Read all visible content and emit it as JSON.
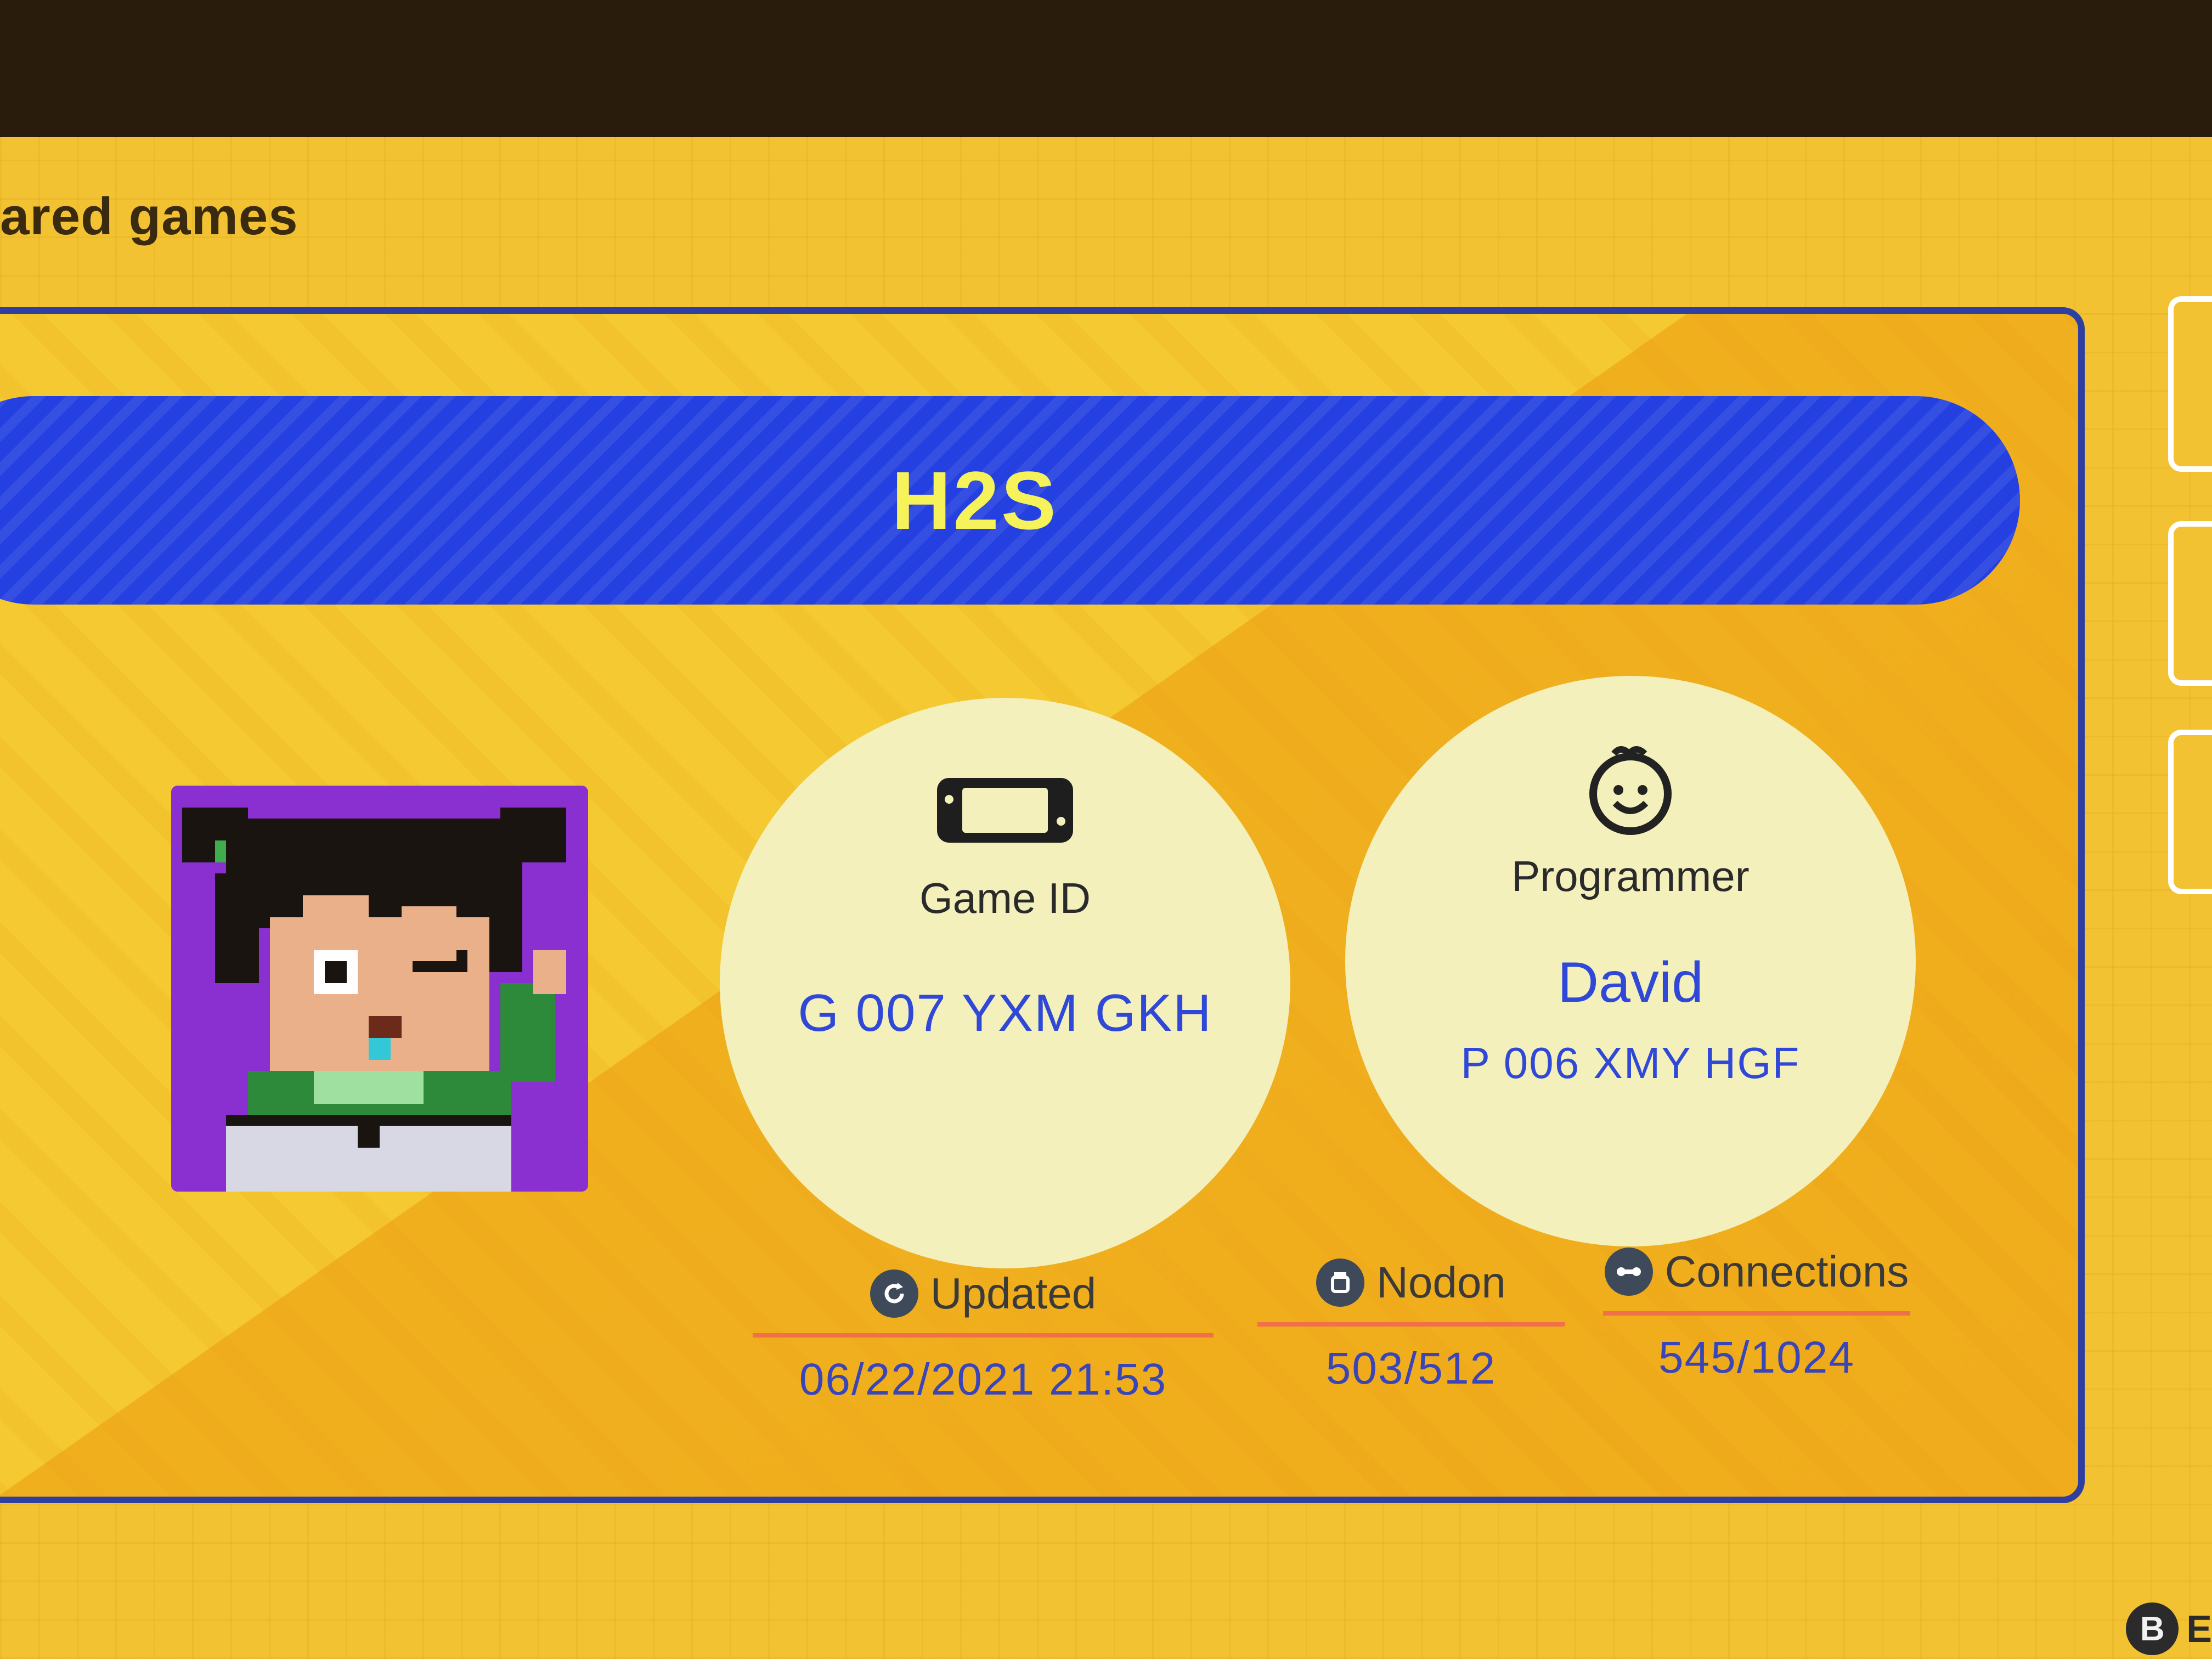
{
  "header": {
    "section_title": "ared games"
  },
  "game": {
    "title": "H2S",
    "thumbnail_icon": "pixel-art-character-thumbnail",
    "game_id": {
      "label": "Game ID",
      "value": "G 007 YXM GKH",
      "icon": "game-console-icon"
    },
    "programmer": {
      "label": "Programmer",
      "name": "David",
      "id": "P 006 XMY HGF",
      "icon": "programmer-face-icon"
    },
    "stats": {
      "updated": {
        "label": "Updated",
        "value": "06/22/2021 21:53",
        "icon": "refresh-icon"
      },
      "nodon": {
        "label": "Nodon",
        "value": "503/512",
        "icon": "nodon-icon"
      },
      "connections": {
        "label": "Connections",
        "value": "545/1024",
        "icon": "connection-icon"
      }
    }
  },
  "footer": {
    "button_glyph": "B",
    "hint_fragment": "E"
  },
  "colors": {
    "background": "#f2c233",
    "banner": "#2440e0",
    "title_text": "#f6f25a",
    "circle": "#f3f0bb",
    "value_text": "#2f48d8",
    "card_border": "#2f3fa0",
    "stat_underline": "#f0704a"
  }
}
